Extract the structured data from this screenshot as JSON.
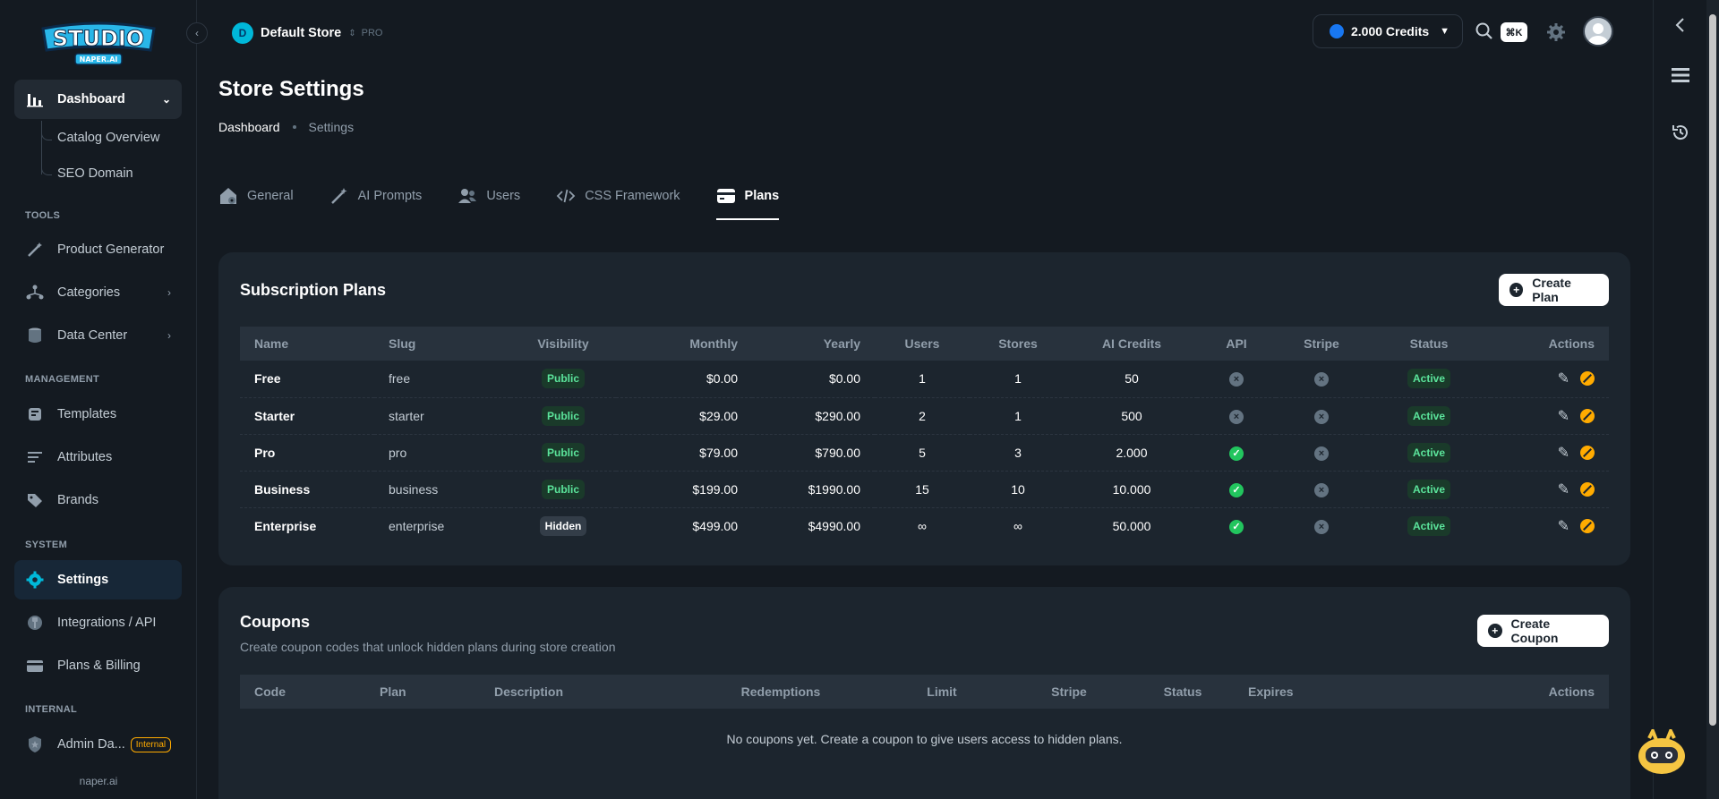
{
  "logo": {
    "title": "STUDIO",
    "subtitle": "NAPER.AI"
  },
  "sidebar": {
    "dashboard": "Dashboard",
    "dashboard_children": [
      "Catalog Overview",
      "SEO Domain"
    ],
    "sections": {
      "tools": "TOOLS",
      "management": "MANAGEMENT",
      "system": "SYSTEM",
      "internal": "INTERNAL"
    },
    "tools": [
      "Product Generator",
      "Categories",
      "Data Center"
    ],
    "management": [
      "Templates",
      "Attributes",
      "Brands"
    ],
    "system": [
      "Settings",
      "Integrations / API",
      "Plans & Billing"
    ],
    "internal": {
      "label": "Admin Da...",
      "badge": "Internal"
    },
    "footer": "naper.ai"
  },
  "header": {
    "store_initial": "D",
    "store_name": "Default Store",
    "store_plan": "PRO",
    "credits": "2.000 Credits",
    "shortcut": "⌘K"
  },
  "page": {
    "title": "Store Settings",
    "breadcrumb": [
      "Dashboard",
      "Settings"
    ],
    "tabs": [
      "General",
      "AI Prompts",
      "Users",
      "CSS Framework",
      "Plans"
    ],
    "active_tab": "Plans"
  },
  "plans": {
    "title": "Subscription Plans",
    "create_label": "Create Plan",
    "columns": [
      "Name",
      "Slug",
      "Visibility",
      "Monthly",
      "Yearly",
      "Users",
      "Stores",
      "AI Credits",
      "API",
      "Stripe",
      "Status",
      "Actions"
    ],
    "rows": [
      {
        "name": "Free",
        "slug": "free",
        "visibility": "Public",
        "monthly": "$0.00",
        "yearly": "$0.00",
        "users": "1",
        "stores": "1",
        "credits": "50",
        "api": false,
        "stripe": false,
        "status": "Active"
      },
      {
        "name": "Starter",
        "slug": "starter",
        "visibility": "Public",
        "monthly": "$29.00",
        "yearly": "$290.00",
        "users": "2",
        "stores": "1",
        "credits": "500",
        "api": false,
        "stripe": false,
        "status": "Active"
      },
      {
        "name": "Pro",
        "slug": "pro",
        "visibility": "Public",
        "monthly": "$79.00",
        "yearly": "$790.00",
        "users": "5",
        "stores": "3",
        "credits": "2.000",
        "api": true,
        "stripe": false,
        "status": "Active"
      },
      {
        "name": "Business",
        "slug": "business",
        "visibility": "Public",
        "monthly": "$199.00",
        "yearly": "$1990.00",
        "users": "15",
        "stores": "10",
        "credits": "10.000",
        "api": true,
        "stripe": false,
        "status": "Active"
      },
      {
        "name": "Enterprise",
        "slug": "enterprise",
        "visibility": "Hidden",
        "monthly": "$499.00",
        "yearly": "$4990.00",
        "users": "∞",
        "stores": "∞",
        "credits": "50.000",
        "api": true,
        "stripe": false,
        "status": "Active"
      }
    ]
  },
  "coupons": {
    "title": "Coupons",
    "subtitle": "Create coupon codes that unlock hidden plans during store creation",
    "create_label": "Create Coupon",
    "columns": [
      "Code",
      "Plan",
      "Description",
      "Redemptions",
      "Limit",
      "Stripe",
      "Status",
      "Expires",
      "Actions"
    ],
    "empty": "No coupons yet. Create a coupon to give users access to hidden plans."
  },
  "colors": {
    "accent": "#00b8d9",
    "success": "#22c55e",
    "warning": "#ffab00",
    "surface": "#1c252e",
    "background": "#141a21"
  }
}
